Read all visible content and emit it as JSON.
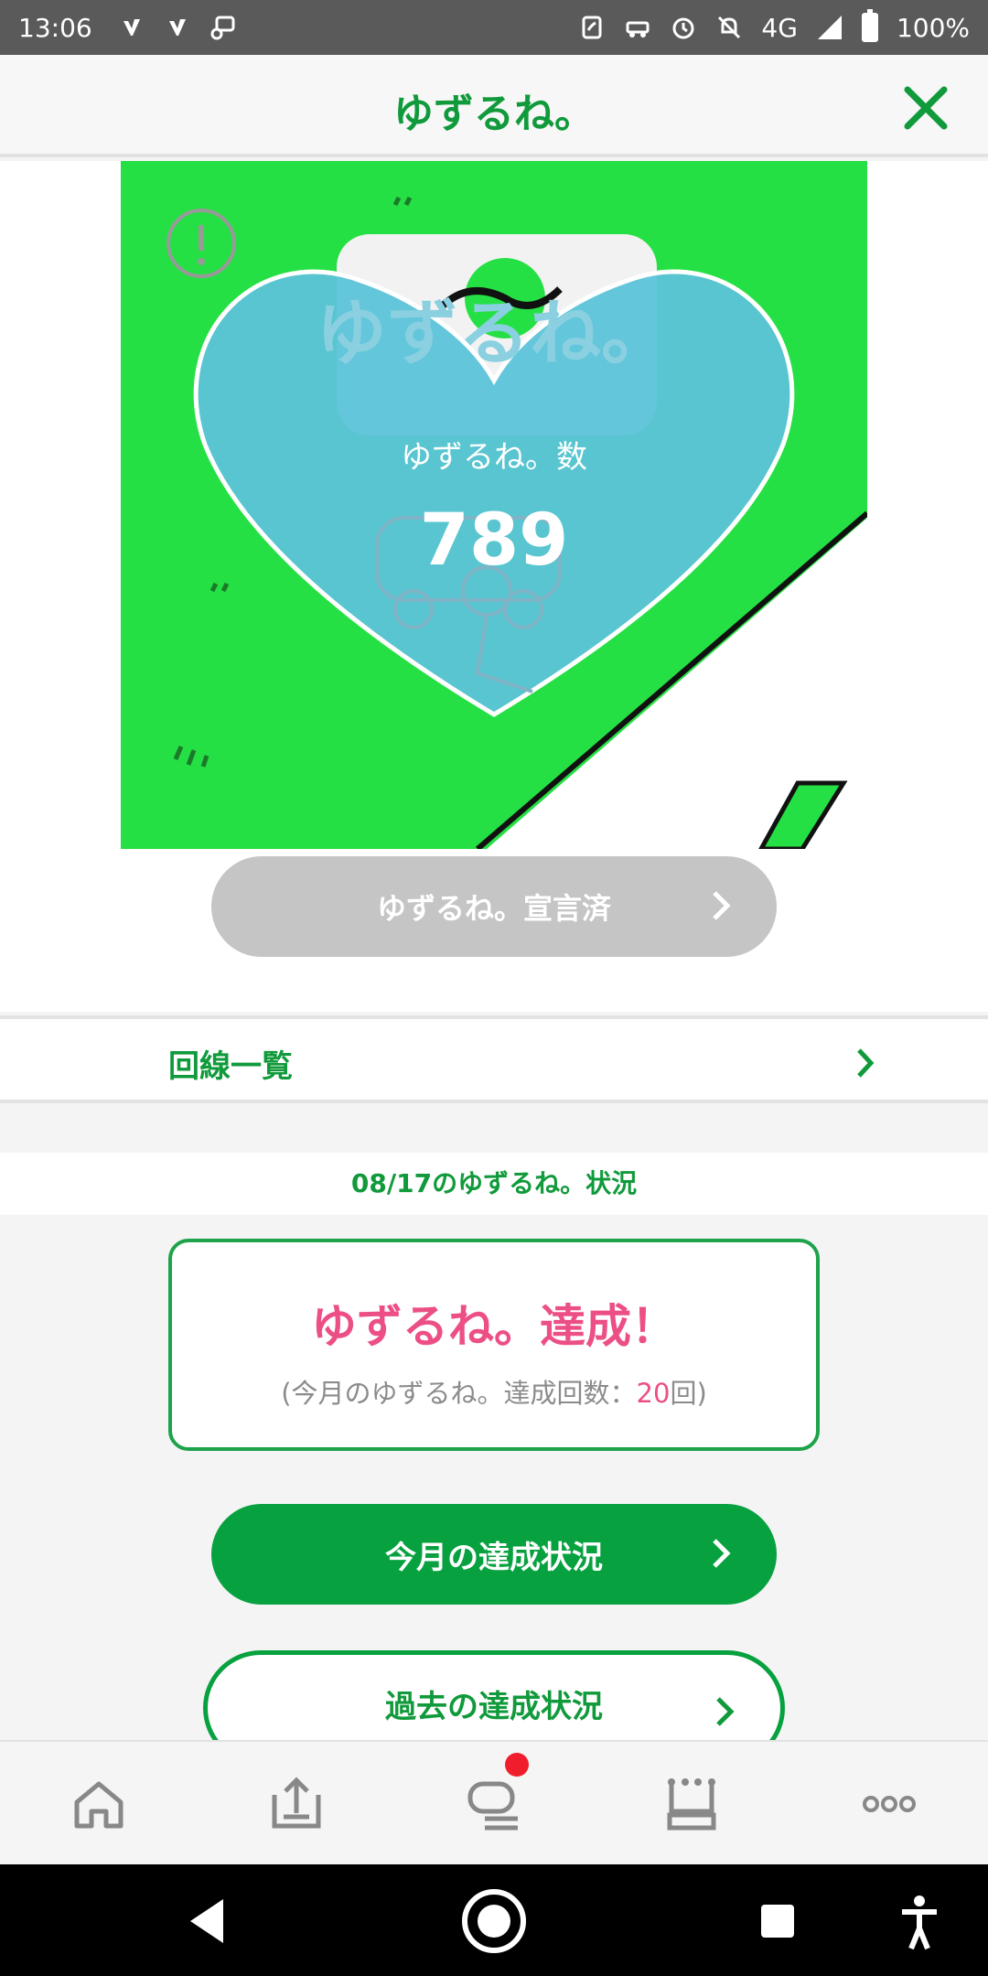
{
  "status_bar": {
    "time": "13:06",
    "network": "4G",
    "battery": "100%"
  },
  "header": {
    "title": "ゆずるね。"
  },
  "hero": {
    "count_label": "ゆずるね。数",
    "count_value": "789",
    "logo_text": "ゆずるね。"
  },
  "declare_button": "ゆずるね。宣言済",
  "line_list": "回線一覧",
  "status": {
    "heading": "08/17のゆずるね。状況",
    "achieved": "ゆずるね。達成！",
    "sub_prefix": "(今月のゆずるね。達成回数：",
    "sub_count": "20",
    "sub_suffix": "回)"
  },
  "buttons": {
    "month": "今月の達成状況",
    "past": "過去の達成状況"
  },
  "colors": {
    "brand_green": "#07a13f",
    "hero_green": "#25e044",
    "heart_blue": "#5bc3d8",
    "accent_pink": "#ec4f86"
  },
  "bottom_nav": [
    "home-icon",
    "upload-icon",
    "chat-icon",
    "crown-icon",
    "more-icon"
  ]
}
